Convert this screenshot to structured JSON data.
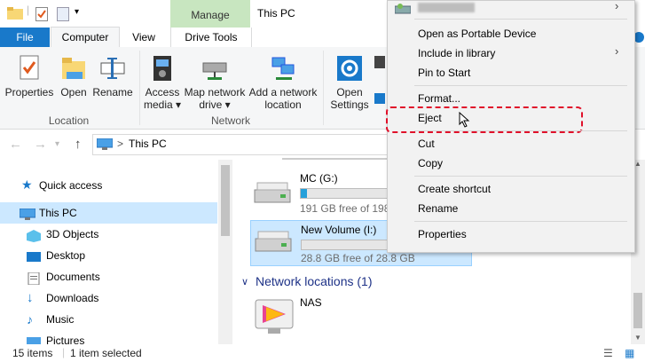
{
  "window": {
    "title": "This PC",
    "context_tab": "Manage"
  },
  "tabs": [
    "File",
    "Computer",
    "View",
    "Drive Tools"
  ],
  "ribbon": {
    "location": {
      "buttons": [
        "Properties",
        "Open",
        "Rename"
      ],
      "group_label": "Location"
    },
    "network": {
      "buttons": [
        {
          "line1": "Access",
          "line2": "media"
        },
        {
          "line1": "Map network",
          "line2": "drive"
        },
        {
          "line1": "Add a network",
          "line2": "location"
        }
      ],
      "group_label": "Network"
    },
    "system": {
      "buttons": [
        {
          "line1": "Open",
          "line2": "Settings"
        }
      ]
    }
  },
  "address": {
    "path": "This PC",
    "separator": ">"
  },
  "nav": {
    "items": [
      "Quick access",
      "This PC",
      "3D Objects",
      "Desktop",
      "Documents",
      "Downloads",
      "Music",
      "Pictures"
    ],
    "selected": "This PC"
  },
  "content": {
    "drives": [
      {
        "name": "MC (G:)",
        "free": "191 GB free of 198",
        "used_fraction": 0.04,
        "selected": false
      },
      {
        "name": "New Volume (I:)",
        "free": "28.8 GB free of 28.8 GB",
        "used_fraction": 0.0,
        "selected": true
      }
    ],
    "network_header": "Network locations (1)",
    "network_items": [
      "NAS"
    ]
  },
  "status": {
    "count": "15 items",
    "selected": "1 item selected"
  },
  "context_menu": {
    "items": [
      "Open as Portable Device",
      "Include in library",
      "Pin to Start",
      "Format...",
      "Eject",
      "Cut",
      "Copy",
      "Create shortcut",
      "Rename",
      "Properties"
    ],
    "highlighted": "Eject"
  },
  "colors": {
    "accent": "#1979ca",
    "manage_tab": "#c8e6c0",
    "selection": "#cce8ff",
    "highlight_border": "#e0102a",
    "drive_bar": "#26a0da"
  }
}
